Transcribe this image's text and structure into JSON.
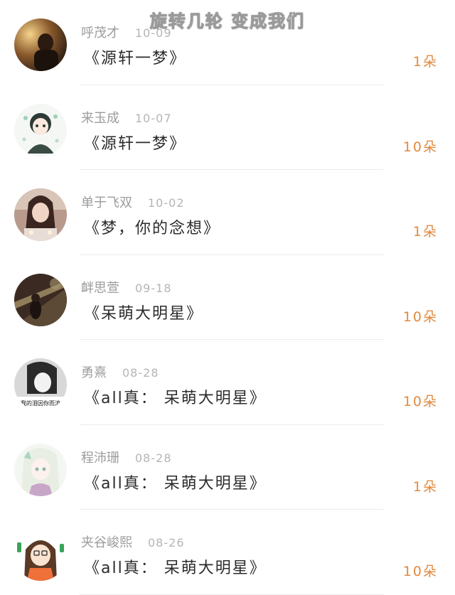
{
  "watermark": "旋转几轮 变成我们",
  "colors": {
    "count": "#e2893e",
    "name": "#9c9c9c",
    "title": "#2b2b2b"
  },
  "gifts": [
    {
      "user": "呼茂才",
      "date": "10-09",
      "title": "《源轩一梦》",
      "count": "1朵"
    },
    {
      "user": "来玉成",
      "date": "10-07",
      "title": "《源轩一梦》",
      "count": "10朵"
    },
    {
      "user": "单于飞双",
      "date": "10-02",
      "title": "《梦，你的念想》",
      "count": "1朵"
    },
    {
      "user": "衅思萱",
      "date": "09-18",
      "title": "《呆萌大明星》",
      "count": "10朵"
    },
    {
      "user": "勇熹",
      "date": "08-28",
      "title": "《all真： 呆萌大明星》",
      "count": "10朵",
      "avatar_caption": "我的泪因你而流"
    },
    {
      "user": "程沛珊",
      "date": "08-28",
      "title": "《all真： 呆萌大明星》",
      "count": "1朵"
    },
    {
      "user": "夹谷峻熙",
      "date": "08-26",
      "title": "《all真： 呆萌大明星》",
      "count": "10朵"
    }
  ]
}
